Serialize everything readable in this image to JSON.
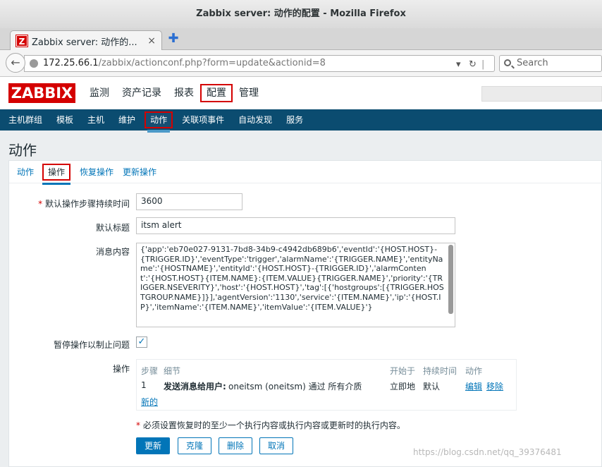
{
  "window": {
    "title": "Zabbix server: 动作的配置 - Mozilla Firefox"
  },
  "browser": {
    "tab_title": "Zabbix server: 动作的...",
    "tab_close": "×",
    "new_tab": "✚",
    "url_host": "172.25.66.1",
    "url_path": "/zabbix/actionconf.php?form=update&actionid=8",
    "search_placeholder": "Search",
    "favicon_letter": "Z"
  },
  "zabbix": {
    "logo": "ZABBIX",
    "menu": [
      "监测",
      "资产记录",
      "报表",
      "配置",
      "管理"
    ],
    "selected_menu": "配置",
    "submenu": [
      "主机群组",
      "模板",
      "主机",
      "维护",
      "动作",
      "关联项事件",
      "自动发现",
      "服务"
    ],
    "selected_submenu": "动作"
  },
  "page": {
    "title": "动作",
    "tabs": [
      "动作",
      "操作",
      "恢复操作",
      "更新操作"
    ],
    "selected_tab": "操作"
  },
  "form": {
    "req_mark": "*",
    "step_duration_label": "默认操作步骤持续时间",
    "step_duration_value": "3600",
    "subject_label": "默认标题",
    "subject_value": "itsm alert",
    "message_label": "消息内容",
    "message_value": "{'app':'eb70e027-9131-7bd8-34b9-c4942db689b6','eventId':'{HOST.HOST}-{TRIGGER.ID}','eventType':'trigger','alarmName':'{TRIGGER.NAME}','entityName':'{HOSTNAME}','entityId':'{HOST.HOST}-{TRIGGER.ID}','alarmContent':'{HOST.HOST}{ITEM.NAME}:{ITEM.VALUE}{TRIGGER.NAME}','priority':'{TRIGGER.NSEVERITY}','host':'{HOST.HOST}','tag':[{'hostgroups':[{TRIGGER.HOSTGROUP.NAME}]}],'agentVersion':'1130','service':'{ITEM.NAME}','ip':'{HOST.IP}','itemName':'{ITEM.NAME}','itemValue':'{ITEM.VALUE}'}",
    "pause_label": "暂停操作以制止问题",
    "pause_checked": "✓",
    "operations_label": "操作",
    "op_headers": {
      "step": "步骤",
      "details": "细节",
      "start": "开始于",
      "duration": "持续时间",
      "action": "动作"
    },
    "op_row": {
      "step": "1",
      "detail_bold": "发送消息给用户:",
      "detail_rest": " oneitsm (oneitsm) 通过 所有介质",
      "start": "立即地",
      "duration": "默认",
      "edit": "编辑",
      "remove": "移除"
    },
    "new_link": "新的",
    "note": " 必须设置恢复时的至少一个执行内容或执行内容或更新时的执行内容。",
    "buttons": {
      "update": "更新",
      "clone": "克隆",
      "delete": "删除",
      "cancel": "取消"
    }
  },
  "watermark": "https://blog.csdn.net/qq_39376481",
  "colors": {
    "brand": "#d40000",
    "nav": "#0b4c70",
    "link": "#0275b8"
  }
}
